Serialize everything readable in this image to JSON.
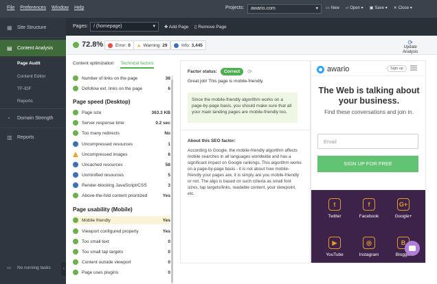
{
  "menubar": {
    "menus": [
      "File",
      "Preferences",
      "Window",
      "Help"
    ],
    "projects_label": "Projects:",
    "project_value": "awario.com",
    "actions": [
      "New",
      "Open",
      "Save",
      "Close"
    ]
  },
  "sidebar": {
    "items": [
      {
        "label": "Site Structure",
        "icon": "site-structure-icon"
      },
      {
        "label": "Content Analysis",
        "icon": "content-analysis-icon"
      },
      {
        "label": "Domain Strength",
        "icon": "domain-strength-icon"
      },
      {
        "label": "Reports",
        "icon": "reports-icon"
      }
    ],
    "subitems": [
      "Page Audit",
      "Content Editor",
      "TF-IDF",
      "Reports"
    ],
    "bottom_status": "No running tasks"
  },
  "pagesbar": {
    "label": "Pages:",
    "value": "/ (homepage)",
    "add_page": "Add Page",
    "remove_page": "Remove Page"
  },
  "stats": {
    "score": "72.8%",
    "error_label": "Error:",
    "error_count": "0",
    "warning_label": "Warning:",
    "warning_count": "29",
    "info_label": "Info:",
    "info_count": "3,445",
    "update_line1": "Update",
    "update_line2": "Analysis"
  },
  "tabs": [
    "Content optimization",
    "Technical factors"
  ],
  "factors_top": [
    {
      "label": "Number of links on the page",
      "value": "38",
      "status": "ok"
    },
    {
      "label": "Dofollow ext. links on the page",
      "value": "6",
      "status": "ok"
    }
  ],
  "section_speed": "Page speed (Desktop)",
  "factors_speed": [
    {
      "label": "Page size",
      "value": "363.3 KB",
      "status": "ok"
    },
    {
      "label": "Server response time",
      "value": "0.2 sec",
      "status": "ok"
    },
    {
      "label": "Too many redirects",
      "value": "No",
      "status": "ok"
    },
    {
      "label": "Uncompressed resources",
      "value": "1",
      "status": "info"
    },
    {
      "label": "Uncompressed images",
      "value": "6",
      "status": "warning"
    },
    {
      "label": "Uncached resources",
      "value": "58",
      "status": "info"
    },
    {
      "label": "Unminified resources",
      "value": "5",
      "status": "info"
    },
    {
      "label": "Render-blocking JavaScript/CSS",
      "value": "3",
      "status": "info"
    },
    {
      "label": "Above-the-fold content prioritized",
      "value": "Yes",
      "status": "ok"
    }
  ],
  "section_usability": "Page usability (Mobile)",
  "factors_usability": [
    {
      "label": "Mobile friendly",
      "value": "Yes",
      "status": "ok"
    },
    {
      "label": "Viewport configured properly",
      "value": "Yes",
      "status": "ok"
    },
    {
      "label": "Too small text",
      "value": "0",
      "status": "ok"
    },
    {
      "label": "Too small tap targets",
      "value": "0",
      "status": "ok"
    },
    {
      "label": "Content outside viewport",
      "value": "0",
      "status": "ok"
    },
    {
      "label": "Page uses plugins",
      "value": "0",
      "status": "ok"
    }
  ],
  "detail": {
    "factor_status_label": "Factor status:",
    "status": "Correct",
    "good_job": "Great job! This page is mobile-friendly.",
    "info": "Since the mobile-friendly algorithm works on a page-by-page basis, you should make sure that all your main landing pages are mobile-friendly too.",
    "about_heading": "About this SEO factor:",
    "about_text": "According to Google, the mobile-friendly algorithm affects mobile searches in all languages worldwide and has a significant impact on Google rankings. This algorithm works on a page-by-page basis - it is not about how mobile-friendly your pages are, it is simply are you mobile-friendly or not. The algo is based on such criteria as small font sizes, tap targets/links, readable content, your viewpoint, etc."
  },
  "preview": {
    "logo": "awario",
    "signup_small": "Sign up",
    "headline": "The Web is talking about your business.",
    "subline": "Find these conversations and join in.",
    "email_placeholder": "Email",
    "cta": "SIGN UP FOR FREE",
    "social": [
      {
        "label": "Twitter",
        "icon": "twitter-icon",
        "glyph": "t"
      },
      {
        "label": "Facebook",
        "icon": "facebook-icon",
        "glyph": "f"
      },
      {
        "label": "Google+",
        "icon": "google-plus-icon",
        "glyph": "G+"
      },
      {
        "label": "YouTube",
        "icon": "youtube-icon",
        "glyph": "▶"
      },
      {
        "label": "Instagram",
        "icon": "instagram-icon",
        "glyph": "◎"
      },
      {
        "label": "Blogger",
        "icon": "blogger-icon",
        "glyph": "B"
      }
    ]
  },
  "colors": {
    "ok": "#6ab04c",
    "warning": "#f0a330",
    "info": "#3f6fb5",
    "accent": "#4caf50"
  }
}
